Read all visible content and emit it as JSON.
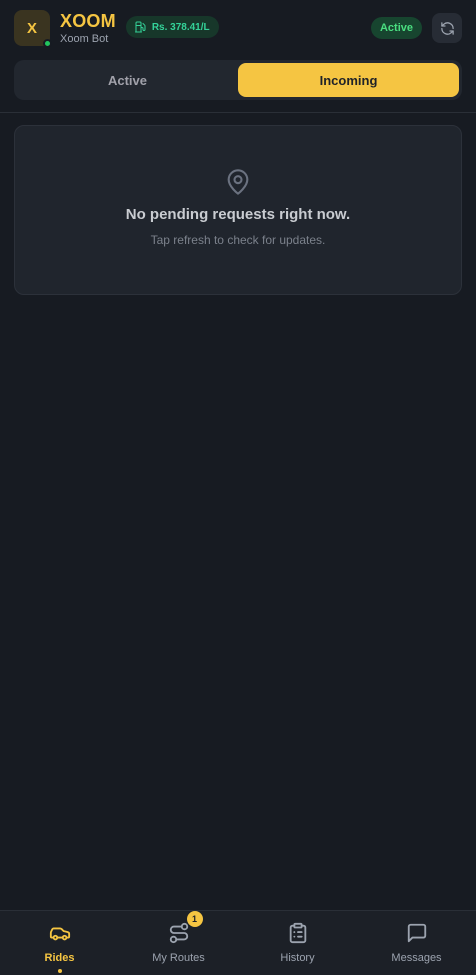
{
  "header": {
    "avatar_letter": "X",
    "brand_title": "XOOM",
    "brand_subtitle": "Xoom Bot",
    "fuel_price": "Rs. 378.41/L",
    "status": "Active"
  },
  "tabs": [
    {
      "label": "Active",
      "selected": false
    },
    {
      "label": "Incoming",
      "selected": true
    }
  ],
  "empty_state": {
    "title": "No pending requests right now.",
    "subtitle": "Tap refresh to check for updates."
  },
  "bottom_nav": [
    {
      "label": "Rides",
      "icon": "car-icon",
      "active": true
    },
    {
      "label": "My Routes",
      "icon": "route-icon",
      "badge": "1"
    },
    {
      "label": "History",
      "icon": "clipboard-icon"
    },
    {
      "label": "Messages",
      "icon": "message-icon"
    }
  ],
  "colors": {
    "background": "#171b22",
    "accent": "#f5c542",
    "success": "#22c55e"
  }
}
